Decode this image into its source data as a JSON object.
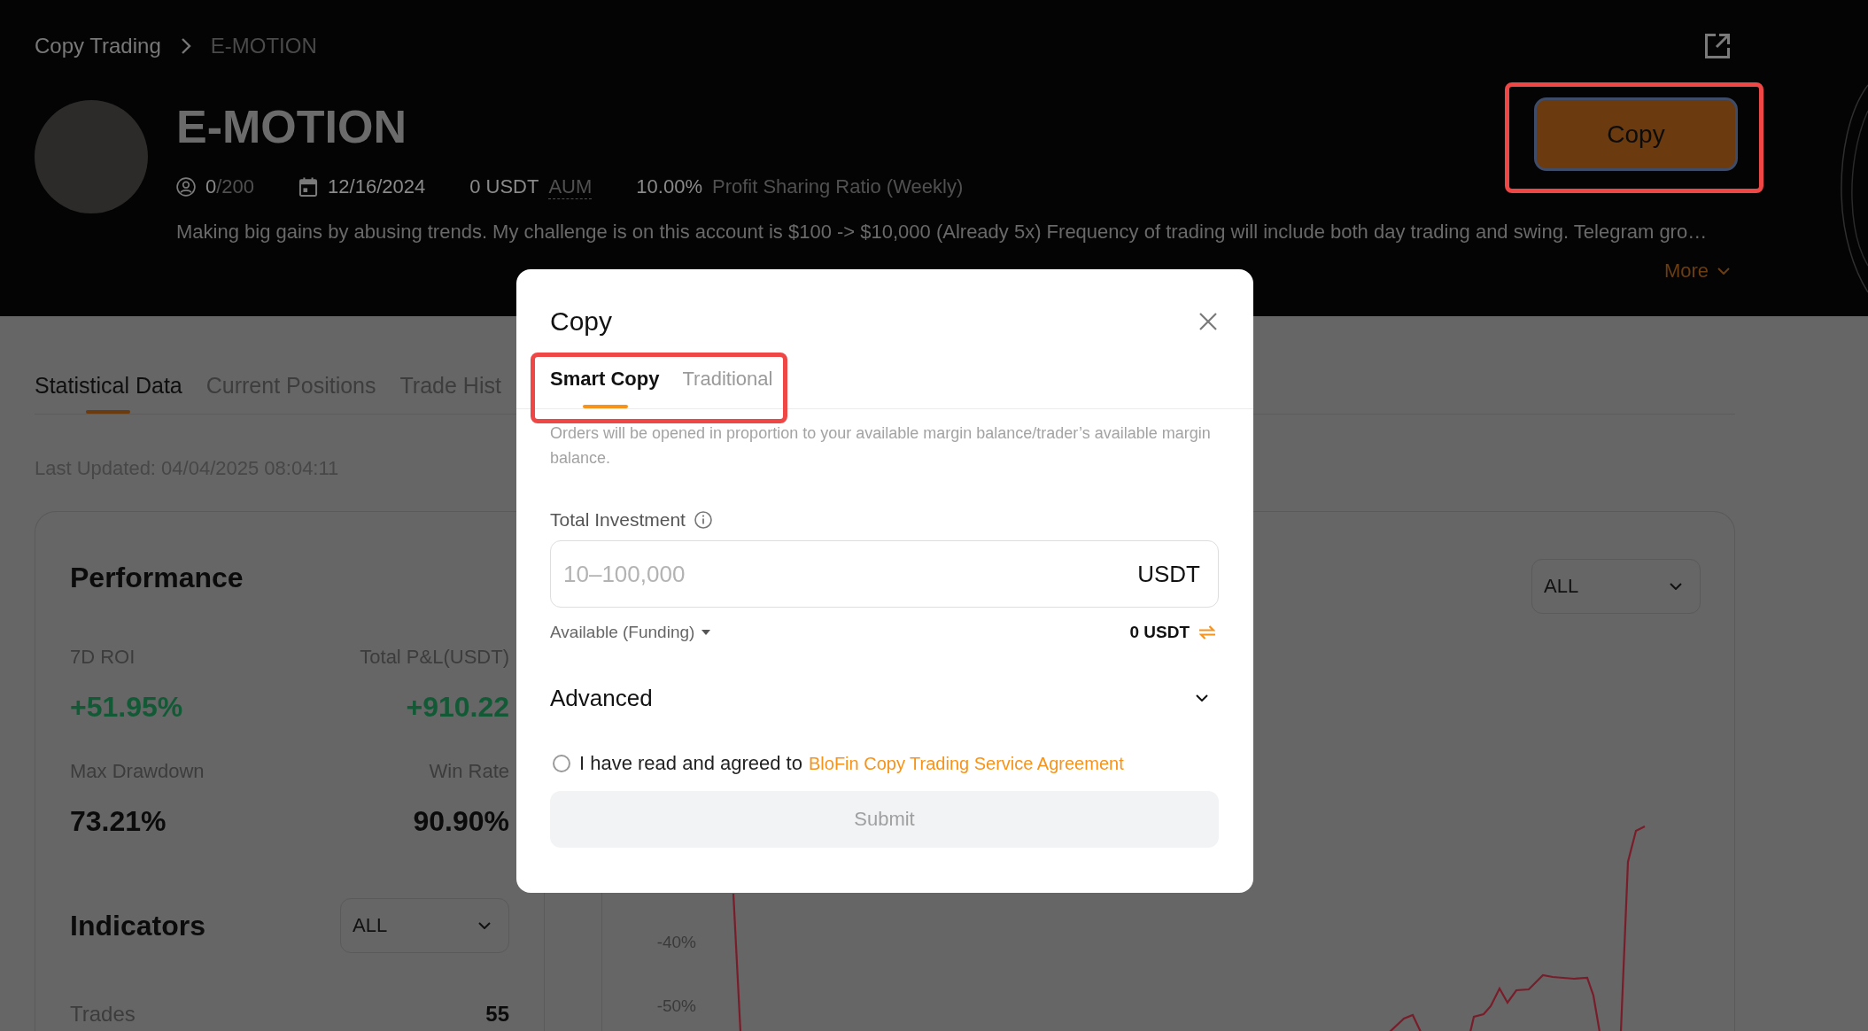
{
  "breadcrumb": [
    {
      "label": "Copy Trading",
      "current": false
    },
    {
      "label": "E-MOTION",
      "current": true
    }
  ],
  "header": {
    "title": "E-MOTION",
    "copiers": "0",
    "copier_limit": "/200",
    "start_date": "12/16/2024",
    "aum_value": "0 USDT",
    "aum_label": "AUM",
    "profit_share": "10.00%",
    "profit_share_label": "Profit Sharing Ratio (Weekly)",
    "description": "Making big gains by abusing trends. My challenge is on this account is $100 -> $10,000 (Already 5x) Frequency of trading will include both day trading and swing. Telegram gro…",
    "more_label": "More",
    "copy_button": {
      "label": "Copy",
      "highlighted": true
    }
  },
  "page_tabs": [
    {
      "label": "Statistical Data",
      "selected": true
    },
    {
      "label": "Current Positions",
      "selected": false
    },
    {
      "label": "Trade Hist",
      "selected": false
    }
  ],
  "last_updated": "Last Updated: 04/04/2025 08:04:11",
  "performance": {
    "title": "Performance",
    "metrics": [
      {
        "label": "7D ROI",
        "value": "+51.95%",
        "kind": "gain"
      },
      {
        "label": "Total P&L(USDT)",
        "value": "+910.22",
        "kind": "gain"
      },
      {
        "label": "Max Drawdown",
        "value": "73.21%",
        "kind": "plain"
      },
      {
        "label": "Win Rate",
        "value": "90.90%",
        "kind": "plain"
      }
    ]
  },
  "indicators": {
    "title": "Indicators",
    "period": "ALL",
    "rows": [
      {
        "label": "Trades",
        "value": "55"
      }
    ]
  },
  "chart_panel": {
    "period": "ALL",
    "y_labels": [
      "-40%",
      "-50%"
    ]
  },
  "modal": {
    "title": "Copy",
    "tabs": [
      {
        "label": "Smart Copy",
        "selected": true
      },
      {
        "label": "Traditional",
        "selected": false
      }
    ],
    "tabs_highlighted": true,
    "note": "Orders will be opened in proportion to your available margin balance/trader’s available margin balance.",
    "investment": {
      "label": "Total Investment",
      "placeholder": "10–100,000",
      "unit": "USDT"
    },
    "available": {
      "label": "Available (Funding)",
      "value": "0 USDT"
    },
    "advanced": {
      "label": "Advanced",
      "expanded": false
    },
    "agreement": {
      "checked": false,
      "text": "I have read and agreed to",
      "link": "BloFin Copy Trading Service Agreement"
    },
    "submit": {
      "label": "Submit",
      "disabled": true
    }
  }
}
